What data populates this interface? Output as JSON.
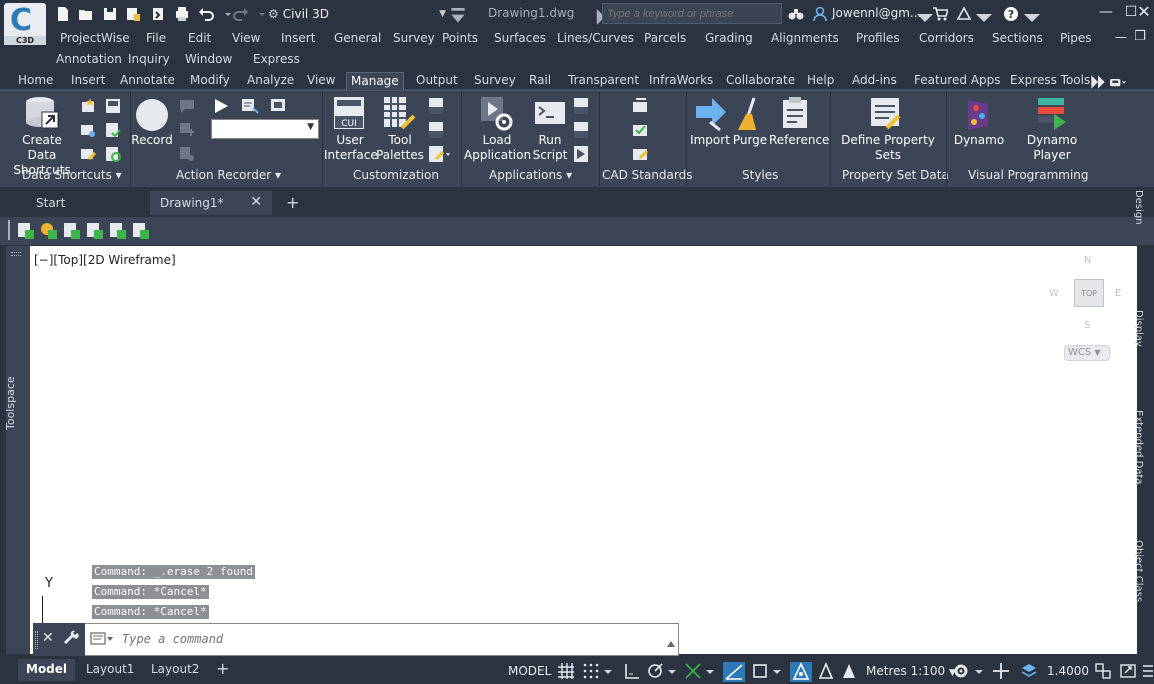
{
  "app": {
    "logo_text": "C3D",
    "workspace": "Civil 3D",
    "document_title": "Drawing1.dwg",
    "search_placeholder": "Type a keyword or phrase",
    "user": "Jowennl@gm..."
  },
  "menu_row1": [
    "ProjectWise",
    "File",
    "Edit",
    "View",
    "Insert",
    "General",
    "Survey",
    "Points",
    "Surfaces",
    "Lines/Curves",
    "Parcels",
    "Grading",
    "Alignments",
    "Profiles",
    "Corridors",
    "Sections",
    "Pipes"
  ],
  "menu_row2": [
    "Annotation",
    "Inquiry",
    "Window",
    "Express"
  ],
  "ribbon_tabs": [
    "Home",
    "Insert",
    "Annotate",
    "Modify",
    "Analyze",
    "View",
    "Manage",
    "Output",
    "Survey",
    "Rail",
    "Transparent",
    "InfraWorks",
    "Collaborate",
    "Help",
    "Add-ins",
    "Featured Apps",
    "Express Tools"
  ],
  "active_ribbon_tab": "Manage",
  "ribbon": {
    "buttons": {
      "create_data_shortcuts_1": "Create Data",
      "create_data_shortcuts_2": "Shortcuts",
      "record": "Record",
      "user_interface_1": "User",
      "user_interface_2": "Interface",
      "tool_palettes_1": "Tool",
      "tool_palettes_2": "Palettes",
      "load_application_1": "Load",
      "load_application_2": "Application",
      "run_script_1": "Run",
      "run_script_2": "Script",
      "import": "Import",
      "purge": "Purge",
      "reference": "Reference",
      "define_property_sets": "Define Property Sets",
      "dynamo": "Dynamo",
      "dynamo_player": "Dynamo Player"
    },
    "panels": {
      "data_shortcuts": "Data Shortcuts",
      "action_recorder": "Action Recorder",
      "customization": "Customization",
      "applications": "Applications",
      "cad_standards": "CAD Standards",
      "styles": "Styles",
      "property_set_data": "Property Set Data",
      "visual_programming": "Visual Programming"
    }
  },
  "doc_tabs": [
    "Start",
    "Drawing1*"
  ],
  "viewport_label": "[−][Top][2D Wireframe]",
  "toolspace_label": "Toolspace",
  "right_tabs": [
    "Design",
    "Display",
    "Extended Data",
    "Object Class"
  ],
  "viewcube": {
    "n": "N",
    "s": "S",
    "e": "E",
    "w": "W",
    "top": "TOP",
    "wcs": "WCS"
  },
  "ucs_label": "Y",
  "command_history": [
    "Command:  _.erase 2 found",
    "Command: *Cancel*",
    "Command: *Cancel*"
  ],
  "command_placeholder": "Type a command",
  "layout_tabs": [
    "Model",
    "Layout1",
    "Layout2"
  ],
  "status": {
    "model": "MODEL",
    "scale": "Metres 1:100",
    "lineweight": "1.4000"
  },
  "colors": {
    "chrome": "#2b3340",
    "ribbon": "#3b4556",
    "canvas": "#ffffff",
    "accent": "#2e7ab8"
  }
}
